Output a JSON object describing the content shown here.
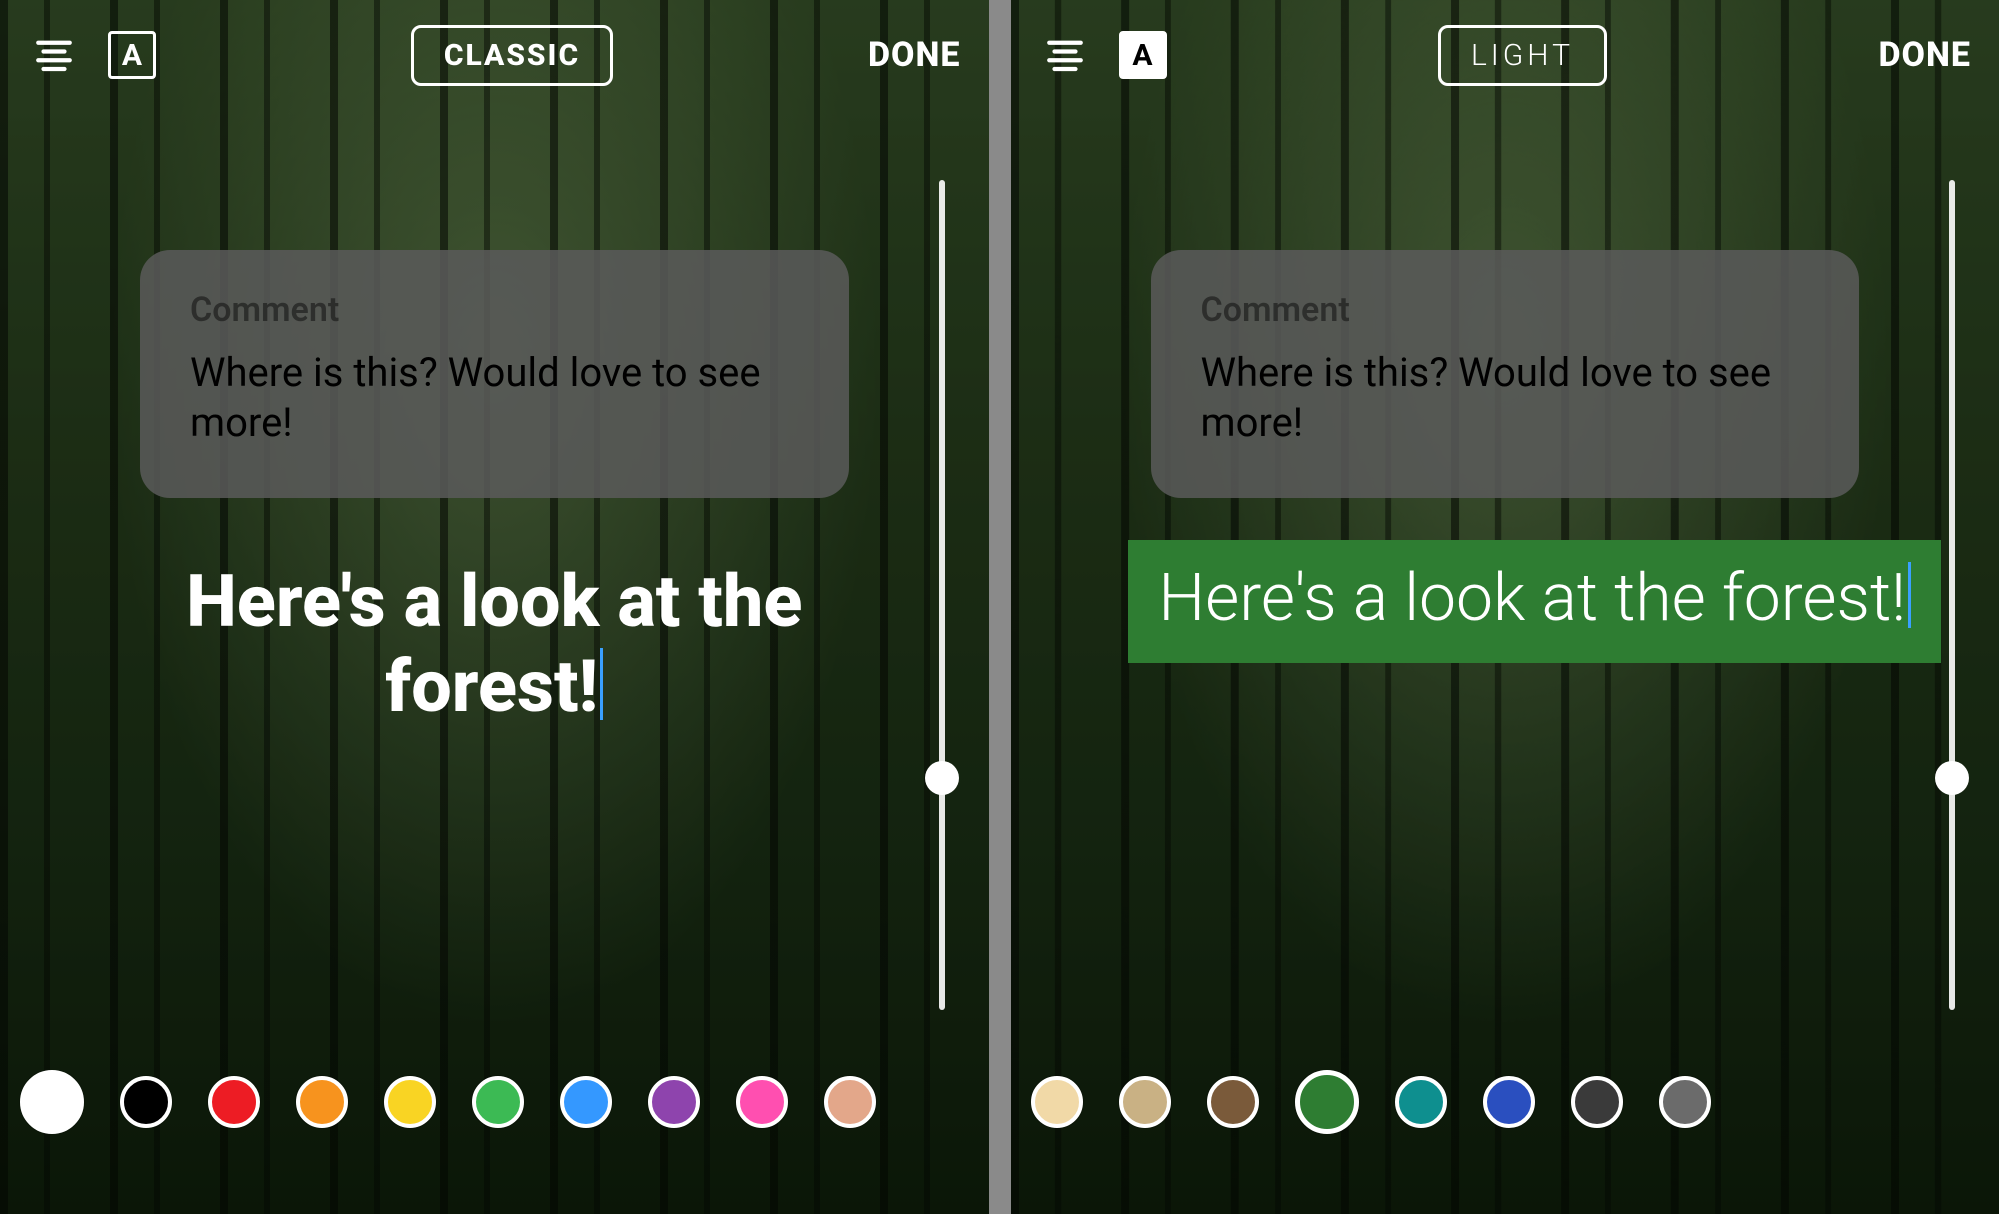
{
  "panels": [
    {
      "toolbar": {
        "align_icon": "align-center-icon",
        "bg_toggle": {
          "letter": "A",
          "filled": false
        },
        "font_label": "CLASSIC",
        "done_label": "DONE"
      },
      "comment": {
        "label": "Comment",
        "body": "Where is this? Would love to see more!"
      },
      "caption": {
        "text": "Here's a look at the forest!",
        "style": "classic",
        "color": "#ffffff"
      },
      "slider": {
        "value": 0.72
      },
      "swatches": [
        {
          "color": "#ffffff",
          "selected": true
        },
        {
          "color": "#000000"
        },
        {
          "color": "#ed1c24"
        },
        {
          "color": "#f7931e"
        },
        {
          "color": "#f9d423"
        },
        {
          "color": "#3cba54"
        },
        {
          "color": "#3498ff"
        },
        {
          "color": "#8e44ad"
        },
        {
          "color": "#ff4fb0"
        },
        {
          "color": "#e3a78a"
        }
      ]
    },
    {
      "toolbar": {
        "align_icon": "align-center-icon",
        "bg_toggle": {
          "letter": "A",
          "filled": true
        },
        "font_label": "LIGHT",
        "done_label": "DONE"
      },
      "comment": {
        "label": "Comment",
        "body": "Where is this? Would love to see more!"
      },
      "caption": {
        "text": "Here's a look at the forest!",
        "style": "light",
        "bg": "#2e7d32",
        "color": "#ffffff"
      },
      "slider": {
        "value": 0.72
      },
      "swatches": [
        {
          "color": "#f1d9a7"
        },
        {
          "color": "#c9b184"
        },
        {
          "color": "#7a5a3a"
        },
        {
          "color": "#2e7d32",
          "selected": true
        },
        {
          "color": "#0e8f8f"
        },
        {
          "color": "#2a4fbf"
        },
        {
          "color": "#3a3a3a"
        },
        {
          "color": "#6b6b6b"
        }
      ]
    }
  ]
}
